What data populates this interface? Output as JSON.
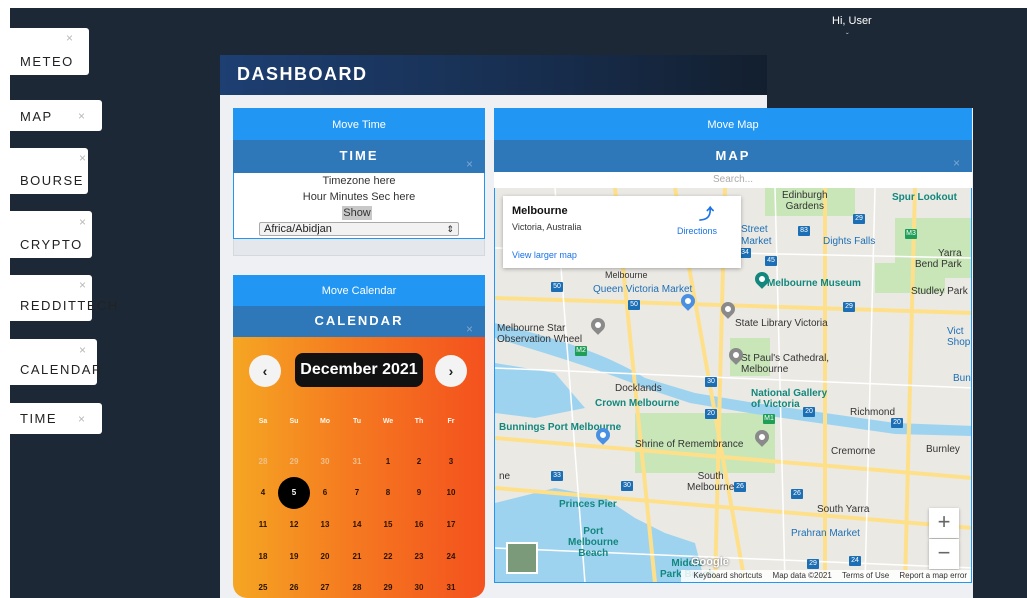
{
  "header": {
    "greeting": "Hi, User",
    "caret": "ˇ"
  },
  "sidebar": {
    "items": [
      {
        "label": "METEO"
      },
      {
        "label": "MAP"
      },
      {
        "label": "BOURSE"
      },
      {
        "label": "CRYPTO"
      },
      {
        "label": "REDDITTECH"
      },
      {
        "label": "CALENDAR"
      },
      {
        "label": "TIME"
      }
    ],
    "close_glyph": "×"
  },
  "dashboard": {
    "title": "DASHBOARD"
  },
  "time_widget": {
    "move_label": "Move Time",
    "title": "TIME",
    "timezone_text": "Timezone here",
    "time_text": "Hour Minutes Sec here",
    "show_label": "Show",
    "timezone_selected": "Africa/Abidjan"
  },
  "calendar_widget": {
    "move_label": "Move Calendar",
    "title": "CALENDAR",
    "month_label": "December 2021",
    "prev_glyph": "‹",
    "next_glyph": "›",
    "weekdays": [
      "Sa",
      "Su",
      "Mo",
      "Tu",
      "We",
      "Th",
      "Fr"
    ],
    "weeks": [
      [
        "28",
        "29",
        "30",
        "31",
        "1",
        "2",
        "3"
      ],
      [
        "4",
        "5",
        "6",
        "7",
        "8",
        "9",
        "10"
      ],
      [
        "11",
        "12",
        "13",
        "14",
        "15",
        "16",
        "17"
      ],
      [
        "18",
        "19",
        "20",
        "21",
        "22",
        "23",
        "24"
      ],
      [
        "25",
        "26",
        "27",
        "28",
        "29",
        "30",
        "31"
      ]
    ],
    "selected_day": "5",
    "muted_days_first_week": 4
  },
  "map_widget": {
    "move_label": "Move Map",
    "title": "MAP",
    "search_placeholder": "Search...",
    "info": {
      "place": "Melbourne",
      "region": "Victoria, Australia",
      "directions": "Directions",
      "larger_map": "View larger map"
    },
    "labels": {
      "edinburgh": "Edinburgh\nGardens",
      "spur": "Spur Lookout",
      "street": "Street",
      "market": "Market",
      "dights": "Dights Falls",
      "yarra_bend": "Yarra\nBend Park",
      "melbourne_partial": "Melbourne",
      "qvm": "Queen Victoria Market",
      "museum": "Melbourne Museum",
      "studley": "Studley Park",
      "star": "Melbourne Star\nObservation Wheel",
      "state_lib": "State Library Victoria",
      "vict": "Vict\nShop",
      "stpauls": "St Paul's Cathedral,\nMelbourne",
      "docklands": "Docklands",
      "crown": "Crown Melbourne",
      "ngv": "National Gallery\nof Victoria",
      "bun": "Bun",
      "richmond": "Richmond",
      "bunnings": "Bunnings Port Melbourne",
      "shrine": "Shrine of Remembrance",
      "cremorne": "Cremorne",
      "burnley": "Burnley",
      "south_melb": "South\nMelbourne",
      "princes": "Princes Pier",
      "port_beach": "Port\nMelbourne\nBeach",
      "south_yarra": "South Yarra",
      "prahran": "Prahran Market",
      "middle_park": "Middle\nPark Beach",
      "ne": "ne"
    },
    "routes": [
      "29",
      "83",
      "M3",
      "34",
      "45",
      "50",
      "50",
      "29",
      "M2",
      "30",
      "20",
      "20",
      "20",
      "M1",
      "33",
      "30",
      "26",
      "26",
      "24",
      "29"
    ],
    "zoom_in": "+",
    "zoom_out": "−",
    "google": "Google",
    "attribution": {
      "shortcuts": "Keyboard shortcuts",
      "data": "Map data ©2021",
      "terms": "Terms of Use",
      "report": "Report a map error"
    },
    "colors": {
      "park": "#c8e6b8",
      "water": "#9ed3f0",
      "road": "#ffe08a",
      "land": "#ebe9e4"
    }
  },
  "colors": {
    "app_bg": "#1c2836",
    "move_bar": "#2196f3",
    "panel_head": "#2e77b8",
    "calendar_start": "#f5a623",
    "calendar_end": "#f4511e"
  }
}
